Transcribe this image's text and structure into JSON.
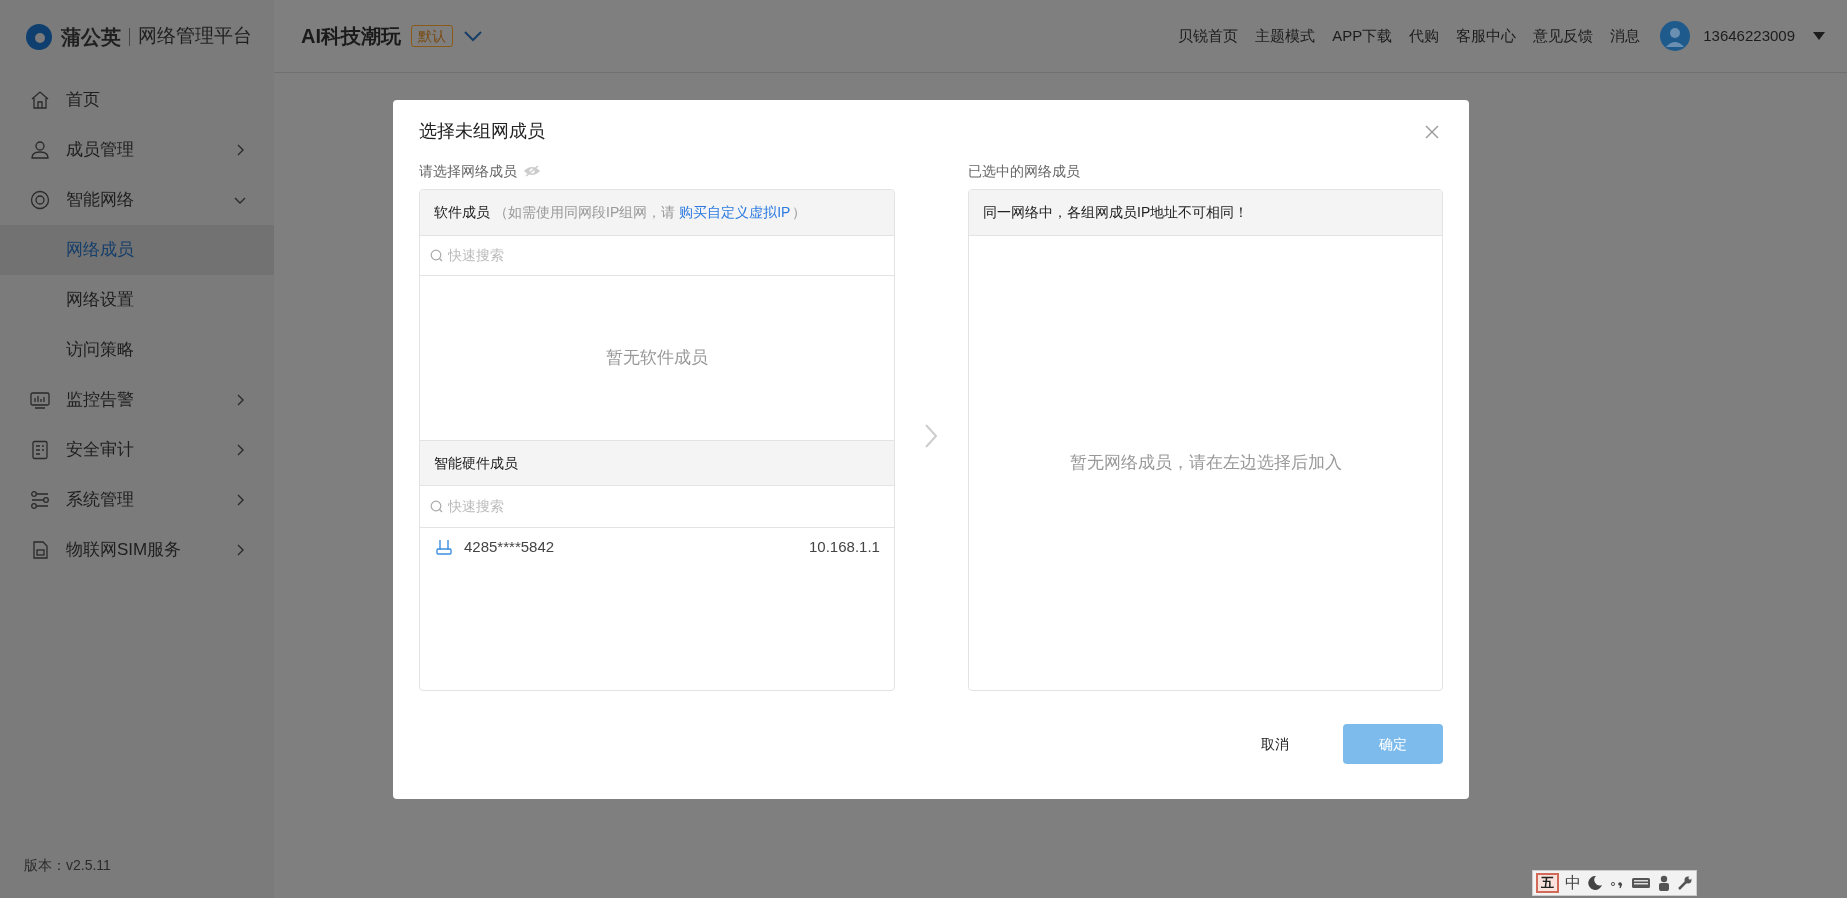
{
  "brand": {
    "name": "蒲公英",
    "subtitle": "网络管理平台"
  },
  "sidebar": {
    "items": [
      {
        "label": "首页",
        "kind": "link"
      },
      {
        "label": "成员管理",
        "kind": "group",
        "expanded": false
      },
      {
        "label": "智能网络",
        "kind": "group",
        "expanded": true,
        "children": [
          {
            "label": "网络成员",
            "selected": true
          },
          {
            "label": "网络设置",
            "selected": false
          },
          {
            "label": "访问策略",
            "selected": false
          }
        ]
      },
      {
        "label": "监控告警",
        "kind": "group",
        "expanded": false
      },
      {
        "label": "安全审计",
        "kind": "group",
        "expanded": false
      },
      {
        "label": "系统管理",
        "kind": "group",
        "expanded": false
      },
      {
        "label": "物联网SIM服务",
        "kind": "group",
        "expanded": false
      }
    ]
  },
  "version": "版本：v2.5.11",
  "header": {
    "network_name": "AI科技潮玩",
    "badge": "默认",
    "links": [
      "贝锐首页",
      "主题模式",
      "APP下载",
      "代购",
      "客服中心",
      "意见反馈",
      "消息"
    ],
    "user": "13646223009"
  },
  "dialog": {
    "title": "选择未组网成员",
    "left": {
      "label": "请选择网络成员",
      "software": {
        "title": "软件成员",
        "hint": "（如需使用同网段IP组网，请",
        "link": "购买自定义虚拟IP",
        "hint_end": "）",
        "search_placeholder": "快速搜索",
        "empty": "暂无软件成员"
      },
      "hardware": {
        "title": "智能硬件成员",
        "search_placeholder": "快速搜索",
        "rows": [
          {
            "name": "4285****5842",
            "ip": "10.168.1.1"
          }
        ]
      }
    },
    "right": {
      "label": "已选中的网络成员",
      "notice": "同一网络中，各组网成员IP地址不可相同！",
      "empty": "暂无网络成员，请在左边选择后加入"
    },
    "cancel": "取消",
    "confirm": {
      "label": "确定",
      "disabled": true
    }
  },
  "ime_toolbar": {
    "mode": "五",
    "language": "中"
  }
}
